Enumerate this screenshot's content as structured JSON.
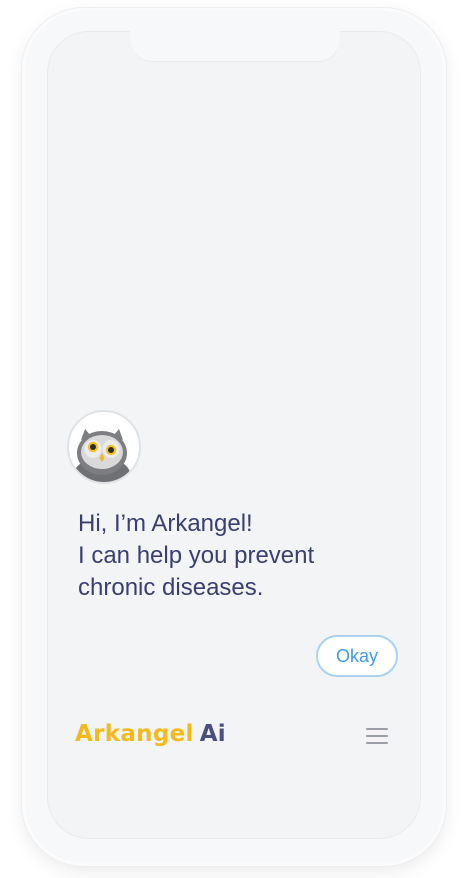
{
  "message": {
    "lines": [
      "Hi, I’m Arkangel!",
      "I can help you prevent",
      "chronic diseases."
    ]
  },
  "okay_button": {
    "label": "Okay"
  },
  "brand": {
    "name": "Arkangel",
    "suffix": "Ai"
  },
  "icons": {
    "avatar": "owl-icon",
    "menu": "hamburger-menu-icon"
  },
  "colors": {
    "message_text": "#3a3f72",
    "button_text": "#3f9ae6",
    "button_border": "#a9d2f5",
    "brand_yellow": "#f4b91a",
    "brand_ai": "#4b4f7f",
    "screen_background": "#f2f4f6"
  }
}
